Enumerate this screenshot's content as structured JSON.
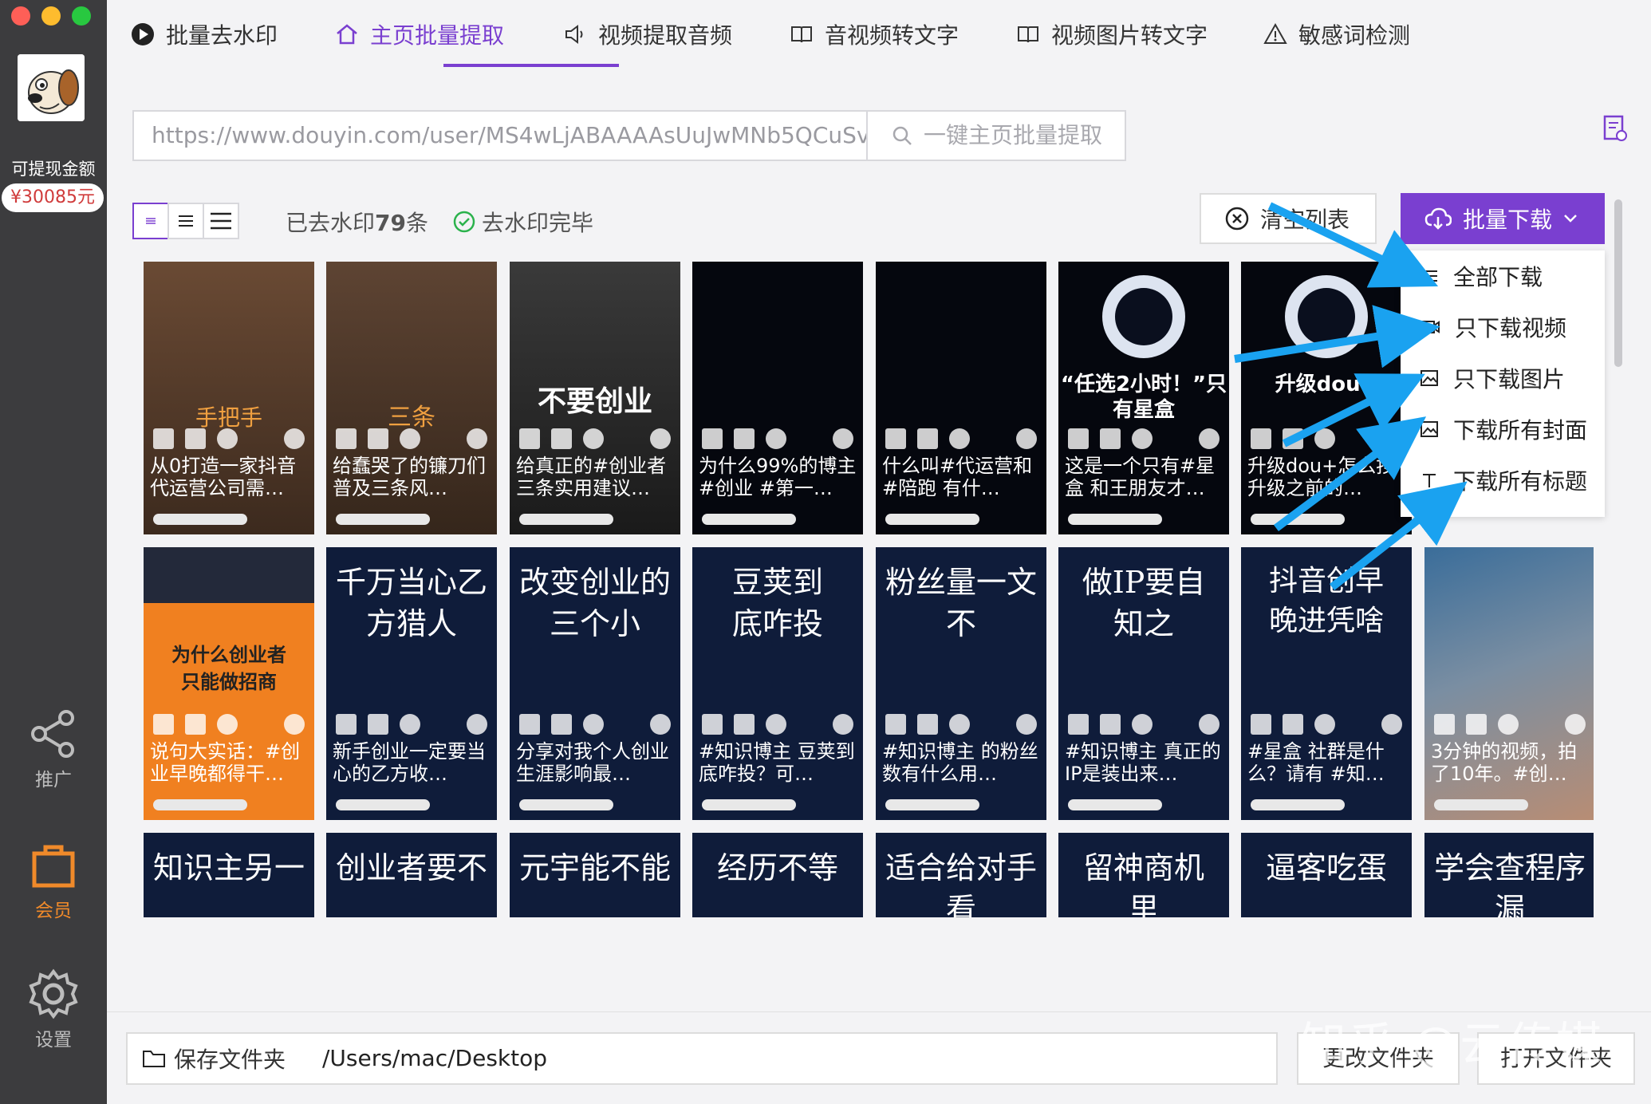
{
  "sidebar": {
    "balance_label": "可提现金额",
    "balance_value": "¥30085元",
    "promote_label": "推广",
    "member_label": "会员",
    "settings_label": "设置"
  },
  "tabs": [
    {
      "label": "批量去水印"
    },
    {
      "label": "主页批量提取"
    },
    {
      "label": "视频提取音频"
    },
    {
      "label": "音视频转文字"
    },
    {
      "label": "视频图片转文字"
    },
    {
      "label": "敏感词检测"
    }
  ],
  "url_value": "https://www.douyin.com/user/MS4wLjABAAAAsUuJwMNb5QCuSvi",
  "search_label": "一键主页批量提取",
  "status": {
    "count_prefix": "已去水印",
    "count_value": "79",
    "count_suffix": "条",
    "done": "去水印完毕"
  },
  "clear_label": "清空列表",
  "batch_label": "批量下载",
  "menu": [
    {
      "label": "全部下载"
    },
    {
      "label": "只下载视频"
    },
    {
      "label": "只下载图片"
    },
    {
      "label": "下载所有封面"
    },
    {
      "label": "下载所有标题"
    }
  ],
  "cards_row1": [
    {
      "overlay": "手把手",
      "caption": "从0打造一家抖音代运营公司需…",
      "bg": "#5a4030",
      "accent": "#e8a040"
    },
    {
      "overlay": "三条",
      "caption": "给蠢哭了的镰刀们普及三条风…",
      "bg": "#4e3a2c",
      "accent": "#e8a040"
    },
    {
      "overlay": "不要创业",
      "caption": "给真正的#创业者三条实用建议…",
      "bg": "#2a2a2a",
      "accent": "#ffffff"
    },
    {
      "overlay": "",
      "caption": "为什么99%的博主#创业 #第一…",
      "bg": "#060810",
      "accent": "#ffffff"
    },
    {
      "overlay": "",
      "caption": "什么叫#代运营和#陪跑 有什…",
      "bg": "#060810",
      "accent": "#ffffff"
    },
    {
      "overlay": "“任选2小时！”只有星盒",
      "caption": "这是一个只有#星盒 和王朋友才…",
      "bg": "#060810",
      "accent": "#ffffff"
    },
    {
      "overlay": "升级dou+",
      "caption": "升级dou+怎么按升级之前的…",
      "bg": "#060810",
      "accent": "#ffffff"
    }
  ],
  "cards_row2": [
    {
      "overlay": "为什么创业者只能做招商",
      "caption": "说句大实话：#创业早晚都得干…",
      "bg": "#f08020"
    },
    {
      "overlay": "千万当心乙方猎人",
      "caption": "新手创业一定要当心的乙方收…",
      "bg": "#132347"
    },
    {
      "overlay": "改变创业的三个小",
      "caption": "分享对我个人创业生涯影响最…",
      "bg": "#132347"
    },
    {
      "overlay": "豆荚到底咋投",
      "caption": "#知识博主 豆荚到底咋投？可…",
      "bg": "#132347"
    },
    {
      "overlay": "粉丝量一文不",
      "caption": "#知识博主 的粉丝数有什么用…",
      "bg": "#132347"
    },
    {
      "overlay": "做IP要自知之",
      "caption": "#知识博主 真正的IP是装出来…",
      "bg": "#132347"
    },
    {
      "overlay": "抖音创早晚进凭啥",
      "caption": "#星盒 社群是什么？请有 #知…",
      "bg": "#132347"
    },
    {
      "overlay": "",
      "caption": "3分钟的视频，拍了10年。#创…",
      "bg": "#1c2430"
    }
  ],
  "cards_row3": [
    {
      "overlay": "知识主另一"
    },
    {
      "overlay": "创业者要不"
    },
    {
      "overlay": "元宇能不能"
    },
    {
      "overlay": "经历不等"
    },
    {
      "overlay": "适合给对手看"
    },
    {
      "overlay": "留神商机里"
    },
    {
      "overlay": "逼客吃蛋"
    },
    {
      "overlay": "学会查程序漏"
    }
  ],
  "bottom": {
    "save_label": "保存文件夹",
    "path": "/Users/mac/Desktop",
    "change_label": "更改文件夹",
    "open_label": "打开文件夹"
  },
  "watermark": "知乎 @云传媒",
  "colors": {
    "accent": "#7a3fd0",
    "arrow": "#1aa2f0",
    "sidebar": "#3c3c3e"
  }
}
